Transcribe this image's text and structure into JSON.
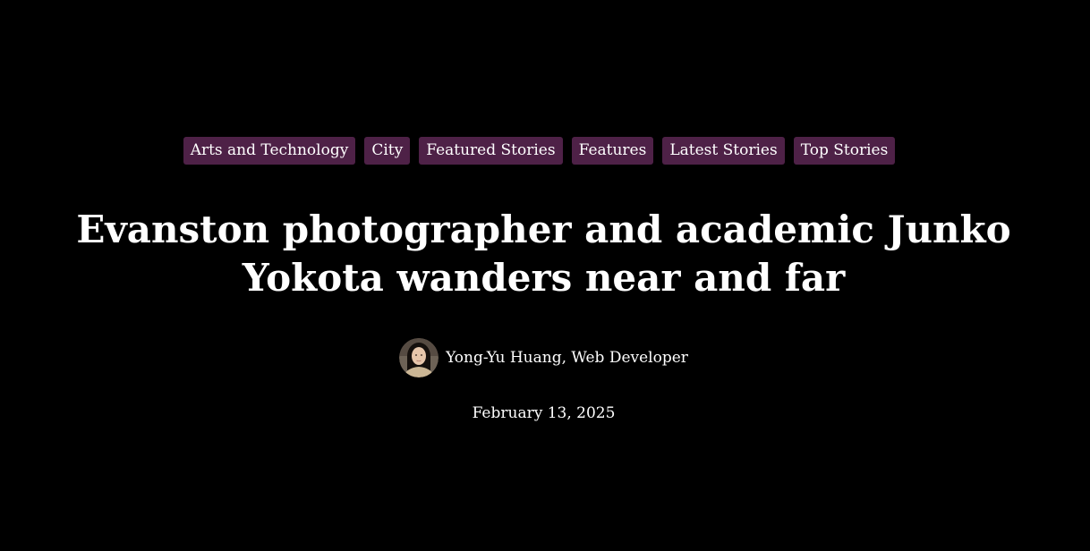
{
  "article": {
    "tags": [
      "Arts and Technology",
      "City",
      "Featured Stories",
      "Features",
      "Latest Stories",
      "Top Stories"
    ],
    "headline": "Evanston photographer and academic Junko Yokota wanders near and far",
    "author": "Yong-Yu Huang, Web Developer",
    "date": "February 13, 2025"
  },
  "colors": {
    "background": "#000000",
    "tag_background": "#4e2147",
    "text": "#ffffff"
  },
  "icons": {
    "avatar": "author-avatar-photo"
  }
}
